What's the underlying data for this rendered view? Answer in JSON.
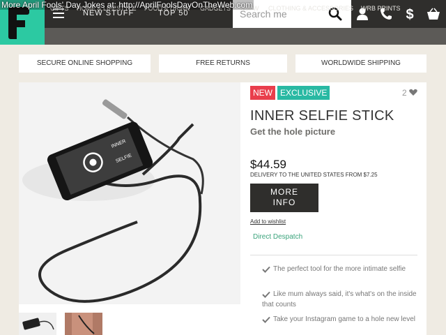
{
  "overlay": {
    "joke_text": "More April Fools' Day Jokes at: http://AprilFoolsDayOnTheWeb.com"
  },
  "header": {
    "nav": [
      "NEW STUFF",
      "TOP 50"
    ],
    "search_placeholder": "Search me"
  },
  "categories": [
    "GIFTS",
    "HOME & LIFESTYLE",
    "FOOD & DRINK",
    "GADGETS",
    "NSFW",
    "CLOTHING & ACCESSORIES",
    "WRB PRINTS"
  ],
  "benefits": [
    "SECURE ONLINE SHOPPING",
    "FREE RETURNS",
    "WORLDWIDE SHIPPING"
  ],
  "product": {
    "badges": [
      "NEW",
      "EXCLUSIVE"
    ],
    "likes": "2",
    "title": "INNER SELFIE STICK",
    "tagline": "Get the hole picture",
    "price": "$44.59",
    "delivery": "DELIVERY TO THE UNITED STATES FROM $7.25",
    "more_info": [
      "MORE",
      "INFO"
    ],
    "wishlist": "Add to wishlist",
    "despatch": "Direct Despatch",
    "features": [
      "The perfect tool for the more intimate selfie",
      "Like mum always said, it's what's on the inside that counts",
      "Take your Instagram game to a hole new level"
    ]
  },
  "colors": {
    "brand_teal": "#2cc9a2",
    "header_dark": "#2f2e2c",
    "category_bar": "#5c5a57",
    "badge_new": "#e93e4c",
    "badge_exclusive": "#29b9a3",
    "despatch_green": "#3aa37b"
  },
  "icons": [
    "hamburger-icon",
    "search-icon",
    "user-icon",
    "phone-icon",
    "dollar-icon",
    "basket-icon",
    "heart-icon",
    "check-icon"
  ]
}
